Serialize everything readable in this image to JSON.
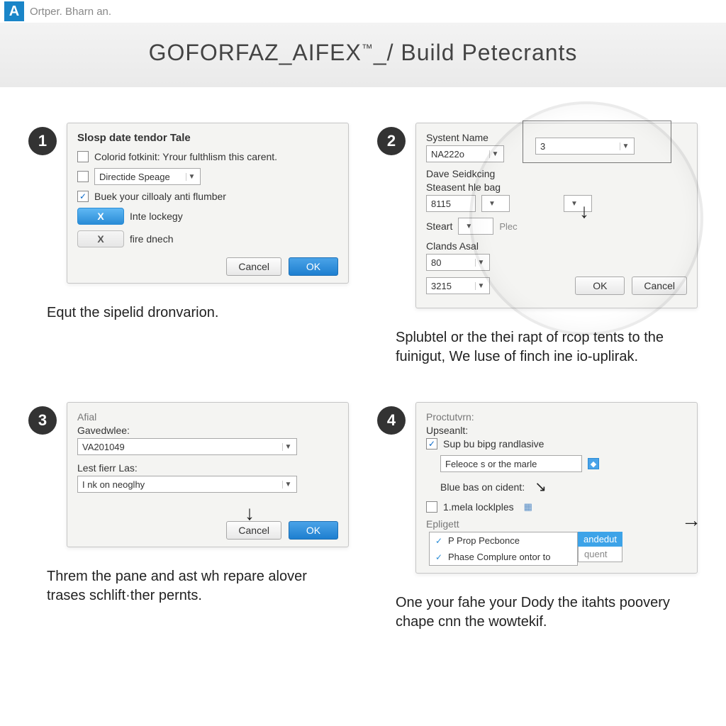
{
  "topbar": {
    "logo_letter": "A",
    "logo_text": "Ortper. Bharn an."
  },
  "banner": {
    "title_left": "GOFORFAZ",
    "title_brand": "AIFEX",
    "tm": "™",
    "title_right": "Build Petecrants"
  },
  "steps": {
    "s1": {
      "num": "1",
      "dialog_title": "Slosp date tendor Tale",
      "chk1_label": "Colorid fotkinit: Yrour fulthlism this carent.",
      "select1_value": "Directide Speage",
      "chk2_label": "Buek your cilloaly anti flumber",
      "pill_x": "X",
      "pill_x_label": "Inte lockegy",
      "pill_x2": "X",
      "pill_x2_label": "fire dnech",
      "cancel": "Cancel",
      "ok": "OK",
      "caption": "Equt the sipelid dronvarion."
    },
    "s2": {
      "num": "2",
      "f_sysname": "Systent Name",
      "v_sysname": "NA222o",
      "f_dave": "Dave Seidkcing",
      "f_steasent": "Steasent hle bag",
      "v_steasent": "8115",
      "f_steart": "Steart",
      "v_steart_hint": "Plec",
      "f_clands": "Clands Asal",
      "v_clands": "80",
      "v_bottom": "3215",
      "top_right_value": "3",
      "ok": "OK",
      "cancel": "Cancel",
      "caption": "Splubtel or the thei rapt of rcop tents to the fuinigut, We luse of finch ine io-uplirak."
    },
    "s3": {
      "num": "3",
      "f_afial": "Afial",
      "f_gaved": "Gavedwlee:",
      "v_gaved": "VA201049",
      "f_lest": "Lest fierr Las:",
      "v_lest": "I nk on neoglhy",
      "cancel": "Cancel",
      "ok": "OK",
      "caption": "Threm the pane and ast wh repare alover trases schlift·ther pernts."
    },
    "s4": {
      "num": "4",
      "f_proc": "Proctutvrn:",
      "f_up": "Upseanlt:",
      "chk1_label": "Sup bu bipg randlasive",
      "v_feleoce": "Feleoce s or the marle",
      "f_blue": "Blue bas on cident:",
      "chk2_label": "1.mela locklples",
      "f_epl": "Epligett",
      "opt1": "P Prop Pecbonce",
      "opt2": "Phase Complure ontor to",
      "hl": "andedut",
      "hint": "quent",
      "caption": "One your fahe your Dody the itahts poovery chape cnn the wowtekif."
    }
  }
}
